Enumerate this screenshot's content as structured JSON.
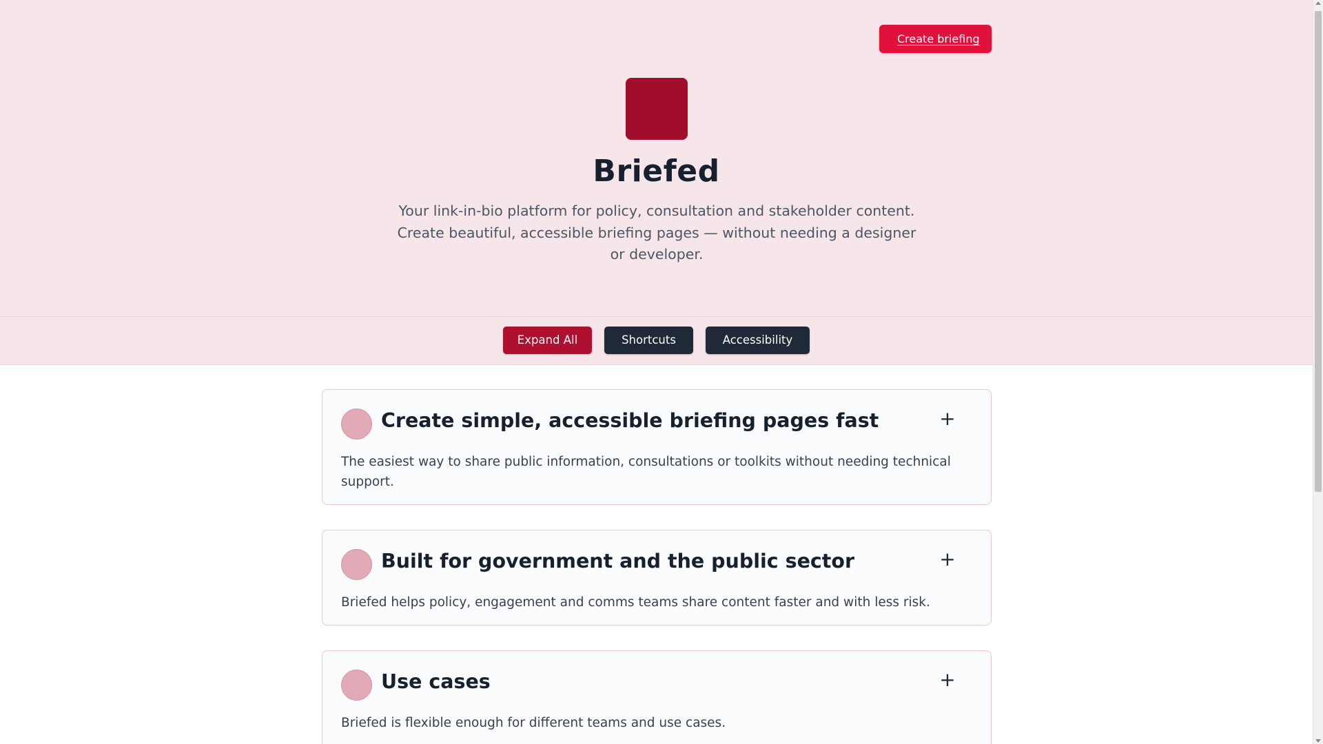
{
  "header": {
    "create_label": "Create briefing"
  },
  "hero": {
    "brand": "Briefed",
    "logo_icon": "brand-logo-square",
    "tagline": "Your link-in-bio platform for policy, consultation and stakeholder content. Create beautiful, accessible briefing pages — without needing a designer or developer."
  },
  "toolbar": {
    "expand_label": "Expand All",
    "shortcuts_label": "Shortcuts",
    "accessibility_label": "Accessibility"
  },
  "sections": [
    {
      "title": "Create simple, accessible briefing pages fast",
      "description": "The easiest way to share public information, consultations or toolkits without needing technical support.",
      "toggle": "+"
    },
    {
      "title": "Built for government and the public sector",
      "description": "Briefed helps policy, engagement and comms teams share content faster and with less risk.",
      "toggle": "+"
    },
    {
      "title": "Use cases",
      "description": "Briefed is flexible enough for different teams and use cases.",
      "toggle": "+"
    }
  ],
  "colors": {
    "hero_background": "#f6e6e9",
    "primary": "#e0123c",
    "brand_dark_red": "#a00e2b",
    "dark_button": "#1f2937",
    "card_border": "#f0c7d0",
    "section_dot": "#e2aab6"
  }
}
